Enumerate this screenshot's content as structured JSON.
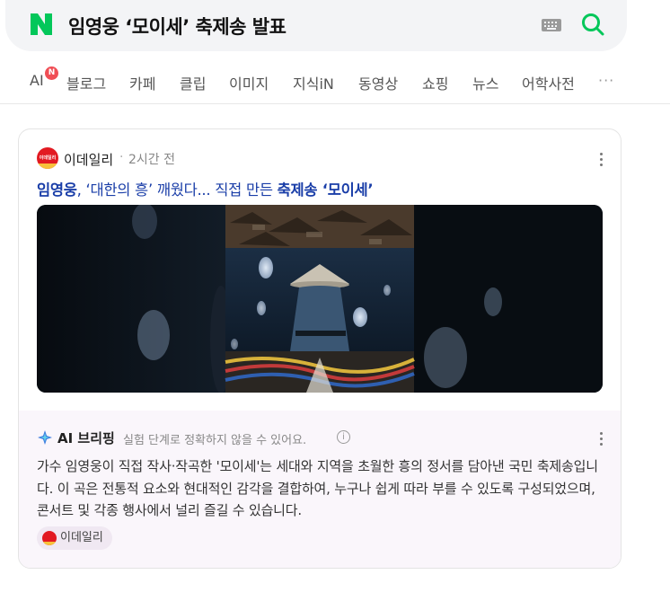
{
  "search": {
    "query": "임영웅 ‘모이세’ 축제송 발표",
    "logo_letter": "N",
    "icons": [
      "keyboard-icon",
      "search-icon"
    ],
    "accent_color": "#03c75a"
  },
  "tabs": {
    "ai_label": "AI",
    "ai_badge": "N",
    "items": [
      "블로그",
      "카페",
      "클립",
      "이미지",
      "지식iN",
      "동영상",
      "쇼핑",
      "뉴스",
      "어학사전"
    ],
    "more": "···"
  },
  "article": {
    "source": "이데일리",
    "separator": "·",
    "time": "2시간 전",
    "source_logo_text": "이데일리",
    "headline_parts": {
      "p1": "임영웅",
      "p2": ", ‘대한의 흥’ 깨웠다... 직접 만든 ",
      "p3": "축제송 ‘모이세’"
    }
  },
  "ai_briefing": {
    "title": "AI 브리핑",
    "note": "실험 단계로 정확하지 않을 수 있어요.",
    "info": "i",
    "body": "가수 임영웅이 직접 작사·작곡한 '모이세'는 세대와 지역을 초월한 흥의 정서를 담아낸 국민 축제송입니다. 이 곡은 전통적 요소와 현대적인 감각을 결합하여, 누구나 쉽게 따라 부를 수 있도록 구성되었으며, 콘서트 및 각종 행사에서 널리 즐길 수 있습니다.",
    "source_chip": "이데일리"
  }
}
